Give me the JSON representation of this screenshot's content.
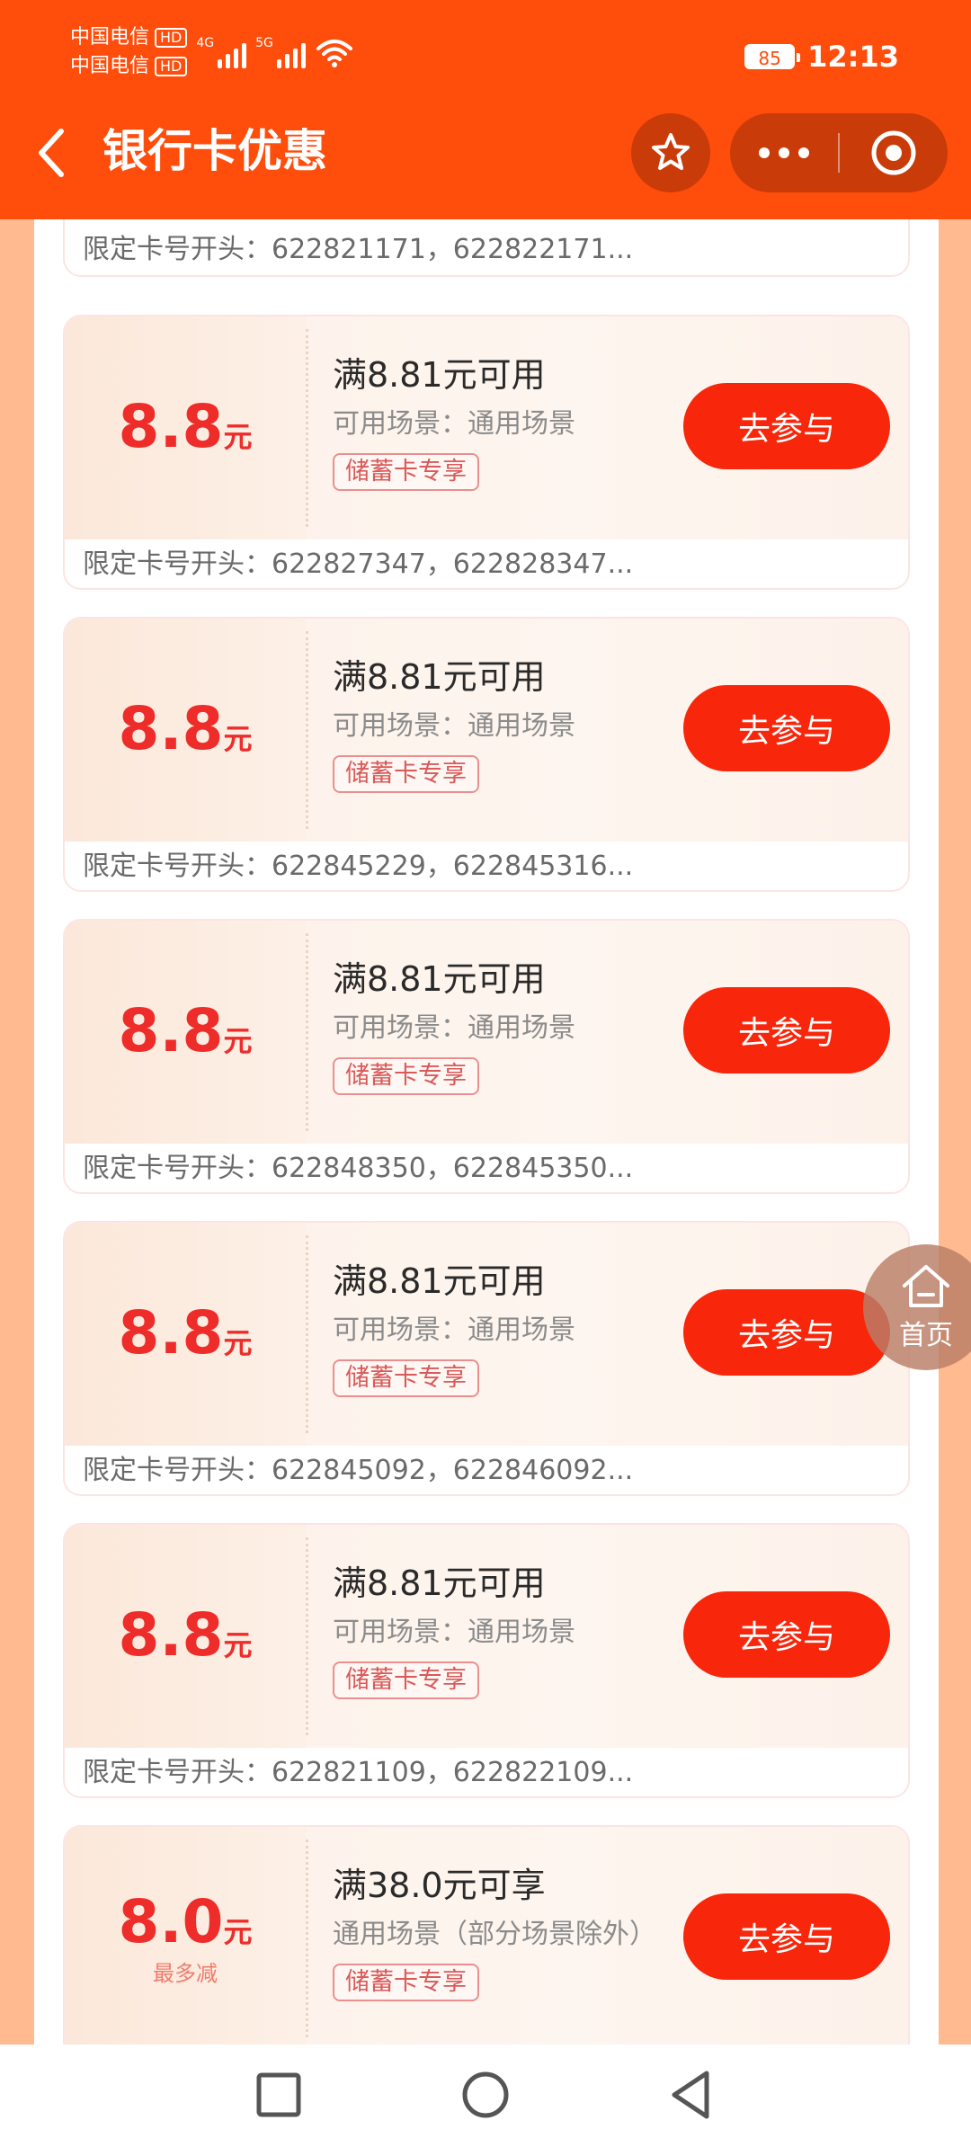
{
  "status_bar": {
    "carrier_1": "中国电信",
    "carrier_2": "中国电信",
    "hd_1": "HD",
    "hd_2": "HD",
    "signal_1_tag": "4G",
    "signal_2_tag": "5G",
    "battery": "85",
    "time": "12:13"
  },
  "nav": {
    "title": "银行卡优惠",
    "icons": {
      "back": "chevron-left-icon",
      "favorite": "star-icon",
      "more": "more-dots-icon",
      "close": "target-icon"
    }
  },
  "partial_card": {
    "limit": "限定卡号开头：622821171，622822171..."
  },
  "cards": [
    {
      "amount": "8.8",
      "unit": "元",
      "sub": "",
      "condition": "满8.81元可用",
      "scene": "可用场景：通用场景",
      "tag": "储蓄卡专享",
      "button": "去参与",
      "limit": "限定卡号开头：622827347，622828347..."
    },
    {
      "amount": "8.8",
      "unit": "元",
      "sub": "",
      "condition": "满8.81元可用",
      "scene": "可用场景：通用场景",
      "tag": "储蓄卡专享",
      "button": "去参与",
      "limit": "限定卡号开头：622845229，622845316..."
    },
    {
      "amount": "8.8",
      "unit": "元",
      "sub": "",
      "condition": "满8.81元可用",
      "scene": "可用场景：通用场景",
      "tag": "储蓄卡专享",
      "button": "去参与",
      "limit": "限定卡号开头：622848350，622845350..."
    },
    {
      "amount": "8.8",
      "unit": "元",
      "sub": "",
      "condition": "满8.81元可用",
      "scene": "可用场景：通用场景",
      "tag": "储蓄卡专享",
      "button": "去参与",
      "limit": "限定卡号开头：622845092，622846092..."
    },
    {
      "amount": "8.8",
      "unit": "元",
      "sub": "",
      "condition": "满8.81元可用",
      "scene": "可用场景：通用场景",
      "tag": "储蓄卡专享",
      "button": "去参与",
      "limit": "限定卡号开头：622821109，622822109..."
    },
    {
      "amount": "8.0",
      "unit": "元",
      "sub": "最多减",
      "condition": "满38.0元可享",
      "scene": "通用场景（部分场景除外）",
      "tag": "储蓄卡专享",
      "button": "去参与",
      "limit": ""
    }
  ],
  "home_float": {
    "label": "首页",
    "icon": "home-icon"
  },
  "system_nav": {
    "recent": "square-icon",
    "home": "circle-icon",
    "back": "triangle-back-icon"
  },
  "colors": {
    "header": "#ff4d0c",
    "accent": "#f8260b",
    "amount": "#ee2c2a",
    "page_bg": "#ffba8f"
  }
}
